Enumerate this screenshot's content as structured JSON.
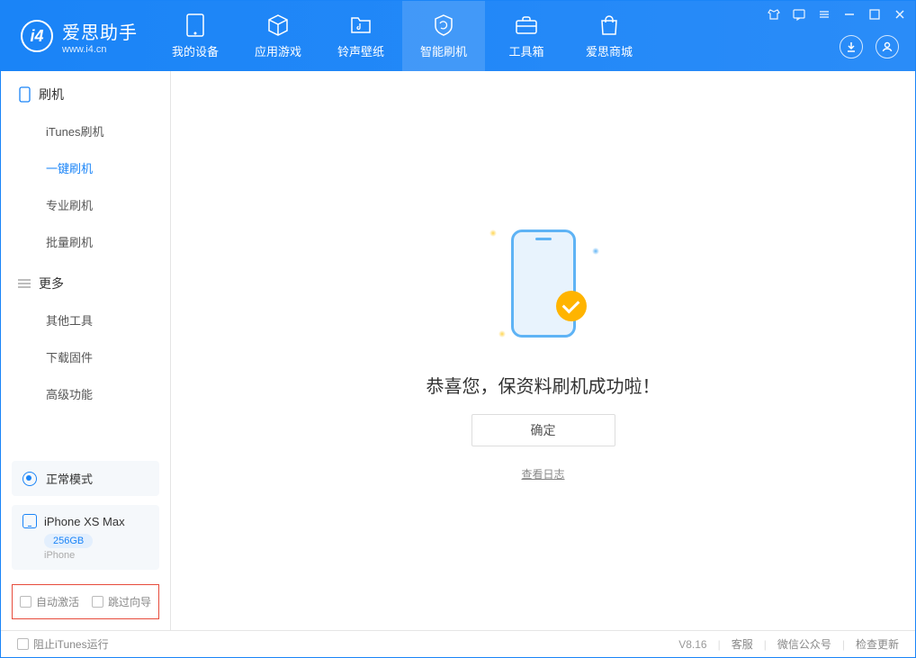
{
  "app": {
    "title": "爱思助手",
    "subtitle": "www.i4.cn"
  },
  "nav": [
    {
      "label": "我的设备"
    },
    {
      "label": "应用游戏"
    },
    {
      "label": "铃声壁纸"
    },
    {
      "label": "智能刷机"
    },
    {
      "label": "工具箱"
    },
    {
      "label": "爱思商城"
    }
  ],
  "sidebar": {
    "section1": {
      "title": "刷机",
      "items": [
        {
          "label": "iTunes刷机"
        },
        {
          "label": "一键刷机"
        },
        {
          "label": "专业刷机"
        },
        {
          "label": "批量刷机"
        }
      ]
    },
    "section2": {
      "title": "更多",
      "items": [
        {
          "label": "其他工具"
        },
        {
          "label": "下载固件"
        },
        {
          "label": "高级功能"
        }
      ]
    },
    "status": "正常模式",
    "device": {
      "name": "iPhone XS Max",
      "storage": "256GB",
      "type": "iPhone"
    },
    "checkboxes": [
      {
        "label": "自动激活"
      },
      {
        "label": "跳过向导"
      }
    ]
  },
  "content": {
    "success_title": "恭喜您，保资料刷机成功啦！",
    "confirm_label": "确定",
    "log_link": "查看日志"
  },
  "footer": {
    "block_itunes": "阻止iTunes运行",
    "version": "V8.16",
    "links": [
      "客服",
      "微信公众号",
      "检查更新"
    ]
  }
}
